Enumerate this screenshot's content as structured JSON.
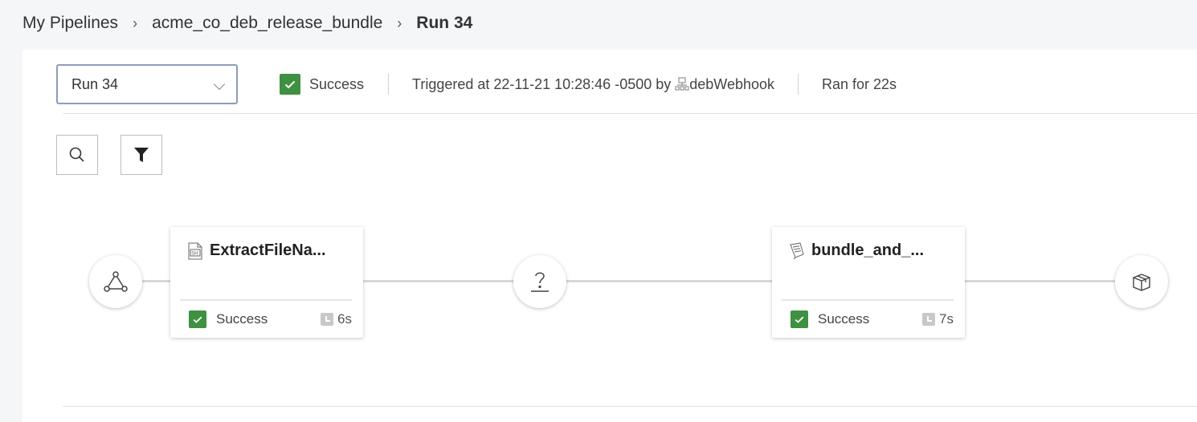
{
  "breadcrumb": {
    "items": [
      "My Pipelines",
      "acme_co_deb_release_bundle",
      "Run 34"
    ],
    "separator": "›"
  },
  "run_select": {
    "value": "Run 34",
    "icon": "chevron-down-icon"
  },
  "run_info": {
    "status": "Success",
    "triggered_prefix": "Triggered at 22-11-21 10:28:46 -0500 by",
    "triggered_by": "debWebhook",
    "ran_for": "Ran for 22s"
  },
  "toolbar": {
    "search_icon": "search-icon",
    "filter_icon": "filter-icon"
  },
  "pipeline": {
    "trigger_node_icon": "webhook-icon",
    "conditional_node_icon": "question-mark-icon",
    "end_node_icon": "package-icon",
    "tasks": [
      {
        "name": "ExtractFileNa...",
        "icon": "shell-script-icon",
        "status": "Success",
        "duration": "6s"
      },
      {
        "name": "bundle_and_...",
        "icon": "release-bundle-icon",
        "status": "Success",
        "duration": "7s"
      }
    ]
  },
  "colors": {
    "success": "#3d9140",
    "select_border": "#8a9cc3",
    "background": "#f5f6f8"
  }
}
